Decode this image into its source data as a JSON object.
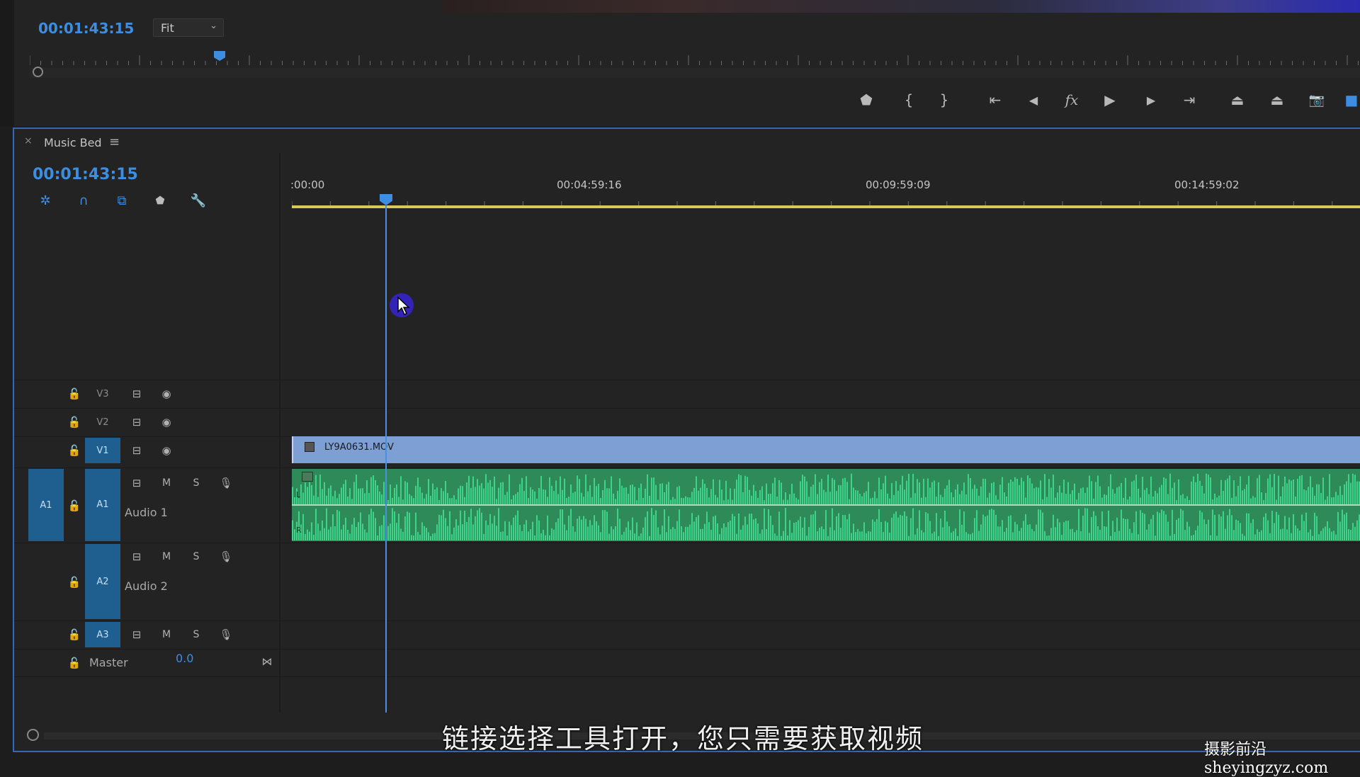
{
  "monitor": {
    "timecode": "00:01:43:15",
    "fit_value": "Fit",
    "controls": [
      {
        "name": "add-marker-icon",
        "glyph": "⬟"
      },
      {
        "name": "mark-in-icon",
        "glyph": "{"
      },
      {
        "name": "mark-out-icon",
        "glyph": "}"
      },
      {
        "name": "go-to-in-icon",
        "glyph": "⇤"
      },
      {
        "name": "step-back-icon",
        "glyph": "◀"
      },
      {
        "name": "fx-icon",
        "glyph": "fx"
      },
      {
        "name": "play-icon",
        "glyph": "▶"
      },
      {
        "name": "step-forward-icon",
        "glyph": "▶"
      },
      {
        "name": "go-to-out-icon",
        "glyph": "⇥"
      },
      {
        "name": "lift-icon",
        "glyph": "⏏"
      },
      {
        "name": "extract-icon",
        "glyph": "⏏"
      },
      {
        "name": "export-frame-icon",
        "glyph": "📷"
      }
    ]
  },
  "timeline": {
    "tab_title": "Music Bed",
    "close_glyph": "×",
    "menu_glyph": "≡",
    "timecode": "00:01:43:15",
    "ruler_labels": [
      ":00:00",
      "00:04:59:16",
      "00:09:59:09",
      "00:14:59:02"
    ],
    "clip_v1_name": "LY9A0631.MOV",
    "tracks": {
      "v3": "V3",
      "v2": "V2",
      "v1": "V1",
      "a1_source": "A1",
      "a1": "A1",
      "a1_name": "Audio 1",
      "a2": "A2",
      "a2_name": "Audio 2",
      "a3": "A3",
      "master_label": "Master",
      "master_value": "0.0",
      "mute": "M",
      "solo": "S",
      "channel_l": "L",
      "channel_r": "R"
    }
  },
  "overlay": {
    "subtitle": "链接选择工具打开，您只需要获取视频",
    "watermark": "摄影前沿 sheyingzyz.com"
  },
  "colors": {
    "accent": "#3d8ee0",
    "video_clip": "#7e9fd3",
    "audio_clip": "#2f8a5a",
    "work_area": "#d6c95a",
    "panel_border": "#3566b8"
  }
}
